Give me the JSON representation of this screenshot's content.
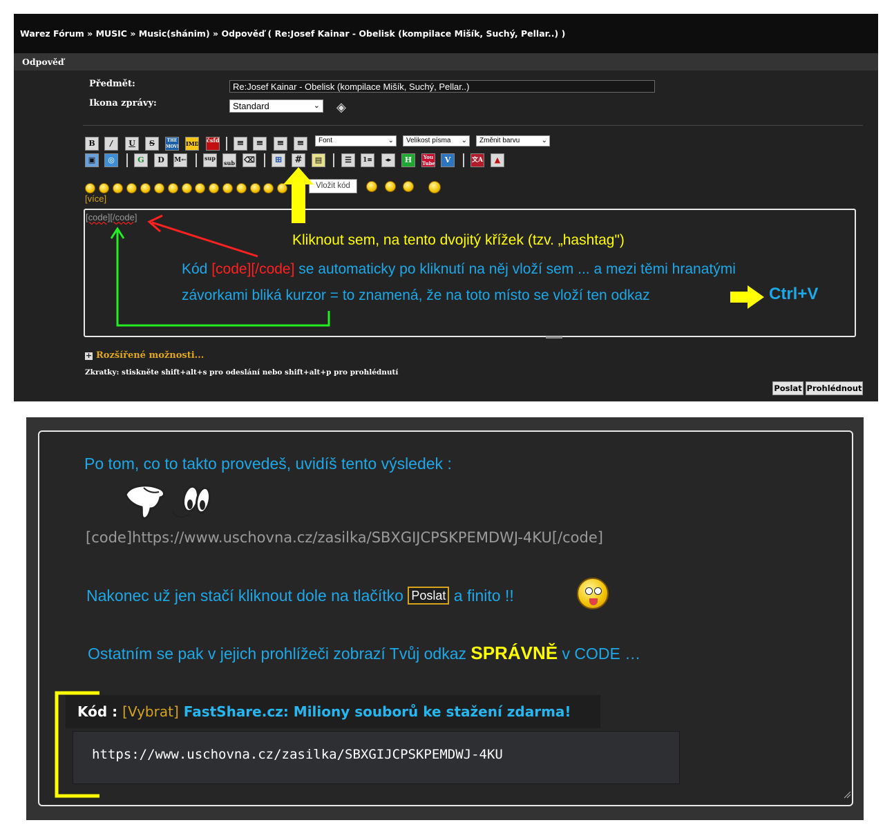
{
  "breadcrumb": {
    "items": [
      "Warez Fórum",
      "MUSIC",
      "Music(shánim)",
      "Odpověď ( Re:Josef Kainar - Obelisk (kompilace Mišík, Suchý, Pellar..) )"
    ],
    "separator": "»"
  },
  "section_title": "Odpověď",
  "form": {
    "subject_label": "Předmět:",
    "subject_value": "Re:Josef Kainar - Obelisk (kompilace Mišík, Suchý, Pellar..)",
    "icon_label": "Ikona zprávy:",
    "icon_value": "Standard"
  },
  "toolbar": {
    "font_label": "Font",
    "size_label": "Velikost písma",
    "color_label": "Změnit barvu",
    "tooltip": "Vložit kód",
    "more_smilies": "[více]"
  },
  "editor": {
    "code_open": "[code]",
    "code_close": "[/code]"
  },
  "annotations": {
    "click_here": "Kliknout sem, na tento dvojitý křížek (tzv. „hashtag\")",
    "line1_a": "Kód ",
    "line1_code": "[code][/code]",
    "line1_b": " se automaticky po kliknutí na něj vloží sem ... a mezi těmi hranatými",
    "line2": "závorkami bliká kurzor = to znamená, že na toto místo se vloží ten odkaz",
    "shortcut": "Ctrl+V"
  },
  "advanced_options": "Rozšířené možnosti...",
  "shortcuts_hint": "Zkratky: stiskněte shift+alt+s pro odeslání nebo shift+alt+p pro prohlédnutí",
  "buttons": {
    "send": "Poslat",
    "preview": "Prohlédnout"
  },
  "result": {
    "intro": "Po tom, co to takto provedeš, uvidíš tento výsledek :",
    "code_line": "[code]https://www.uschovna.cz/zasilka/SBXGIJCPSKPEMDWJ-4KU[/code]",
    "finish_a": "Nakonec už jen stačí kliknout dole na tlačítko",
    "finish_button": "Poslat",
    "finish_b": "a finito !!",
    "others_a": "Ostatním se pak v jejich prohlížeči zobrazí Tvůj odkaz ",
    "others_strong": "SPRÁVNĚ",
    "others_b": " v CODE …",
    "kod_label": "Kód :",
    "kod_select": "[Vybrat]",
    "kod_ad": "FastShare.cz: Miliony souborů ke stažení zdarma!",
    "kod_url": "https://www.uschovna.cz/zasilka/SBXGIJCPSKPEMDWJ-4KU"
  },
  "colors": {
    "annotation_yellow": "#ffff00",
    "annotation_blue": "#1ea8e8",
    "annotation_red": "#ff2020",
    "arrow_green": "#22ee22",
    "link_gold": "#d4a51c"
  },
  "icons": [
    "bold-icon",
    "italic-icon",
    "underline-icon",
    "strike-icon",
    "movie-db-icon",
    "imdb-icon",
    "csfd-icon",
    "align-left-icon",
    "align-center-icon",
    "align-right-icon",
    "justify-icon",
    "image-icon",
    "web-link-icon",
    "google-icon",
    "d-icon",
    "m-icon",
    "sup-icon",
    "sub-icon",
    "eraser-icon",
    "table-icon",
    "code-hash-icon",
    "quote-icon",
    "list-icon",
    "numbered-list-icon",
    "hide-icon",
    "h-icon",
    "youtube-icon",
    "vimeo-icon",
    "translate-icon",
    "warning-icon"
  ]
}
